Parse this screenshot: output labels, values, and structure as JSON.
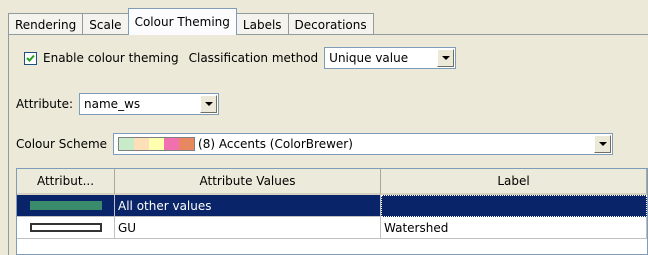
{
  "tabs": [
    "Rendering",
    "Scale",
    "Colour Theming",
    "Labels",
    "Decorations"
  ],
  "active_tab": "Colour Theming",
  "enable": {
    "label": "Enable colour theming",
    "checked": true
  },
  "classification": {
    "label": "Classification method",
    "value": "Unique value"
  },
  "attribute": {
    "label": "Attribute:",
    "value": "name_ws"
  },
  "colour_scheme": {
    "label": "Colour Scheme",
    "value": "(8) Accents (ColorBrewer)",
    "swatches": [
      "#c8ecc8",
      "#fde0b8",
      "#ffffb0",
      "#f070b0",
      "#e88860"
    ]
  },
  "table": {
    "columns": [
      "Attribut...",
      "Attribute Values",
      "Label"
    ],
    "rows": [
      {
        "symbol_fill": "#3a8a6c",
        "symbol_stroke": "#3a8a6c",
        "value": "All other values",
        "label": "",
        "selected": true
      },
      {
        "symbol_fill": "#ffffff",
        "symbol_stroke": "#333333",
        "value": "GU",
        "label": "Watershed",
        "selected": false
      }
    ]
  }
}
